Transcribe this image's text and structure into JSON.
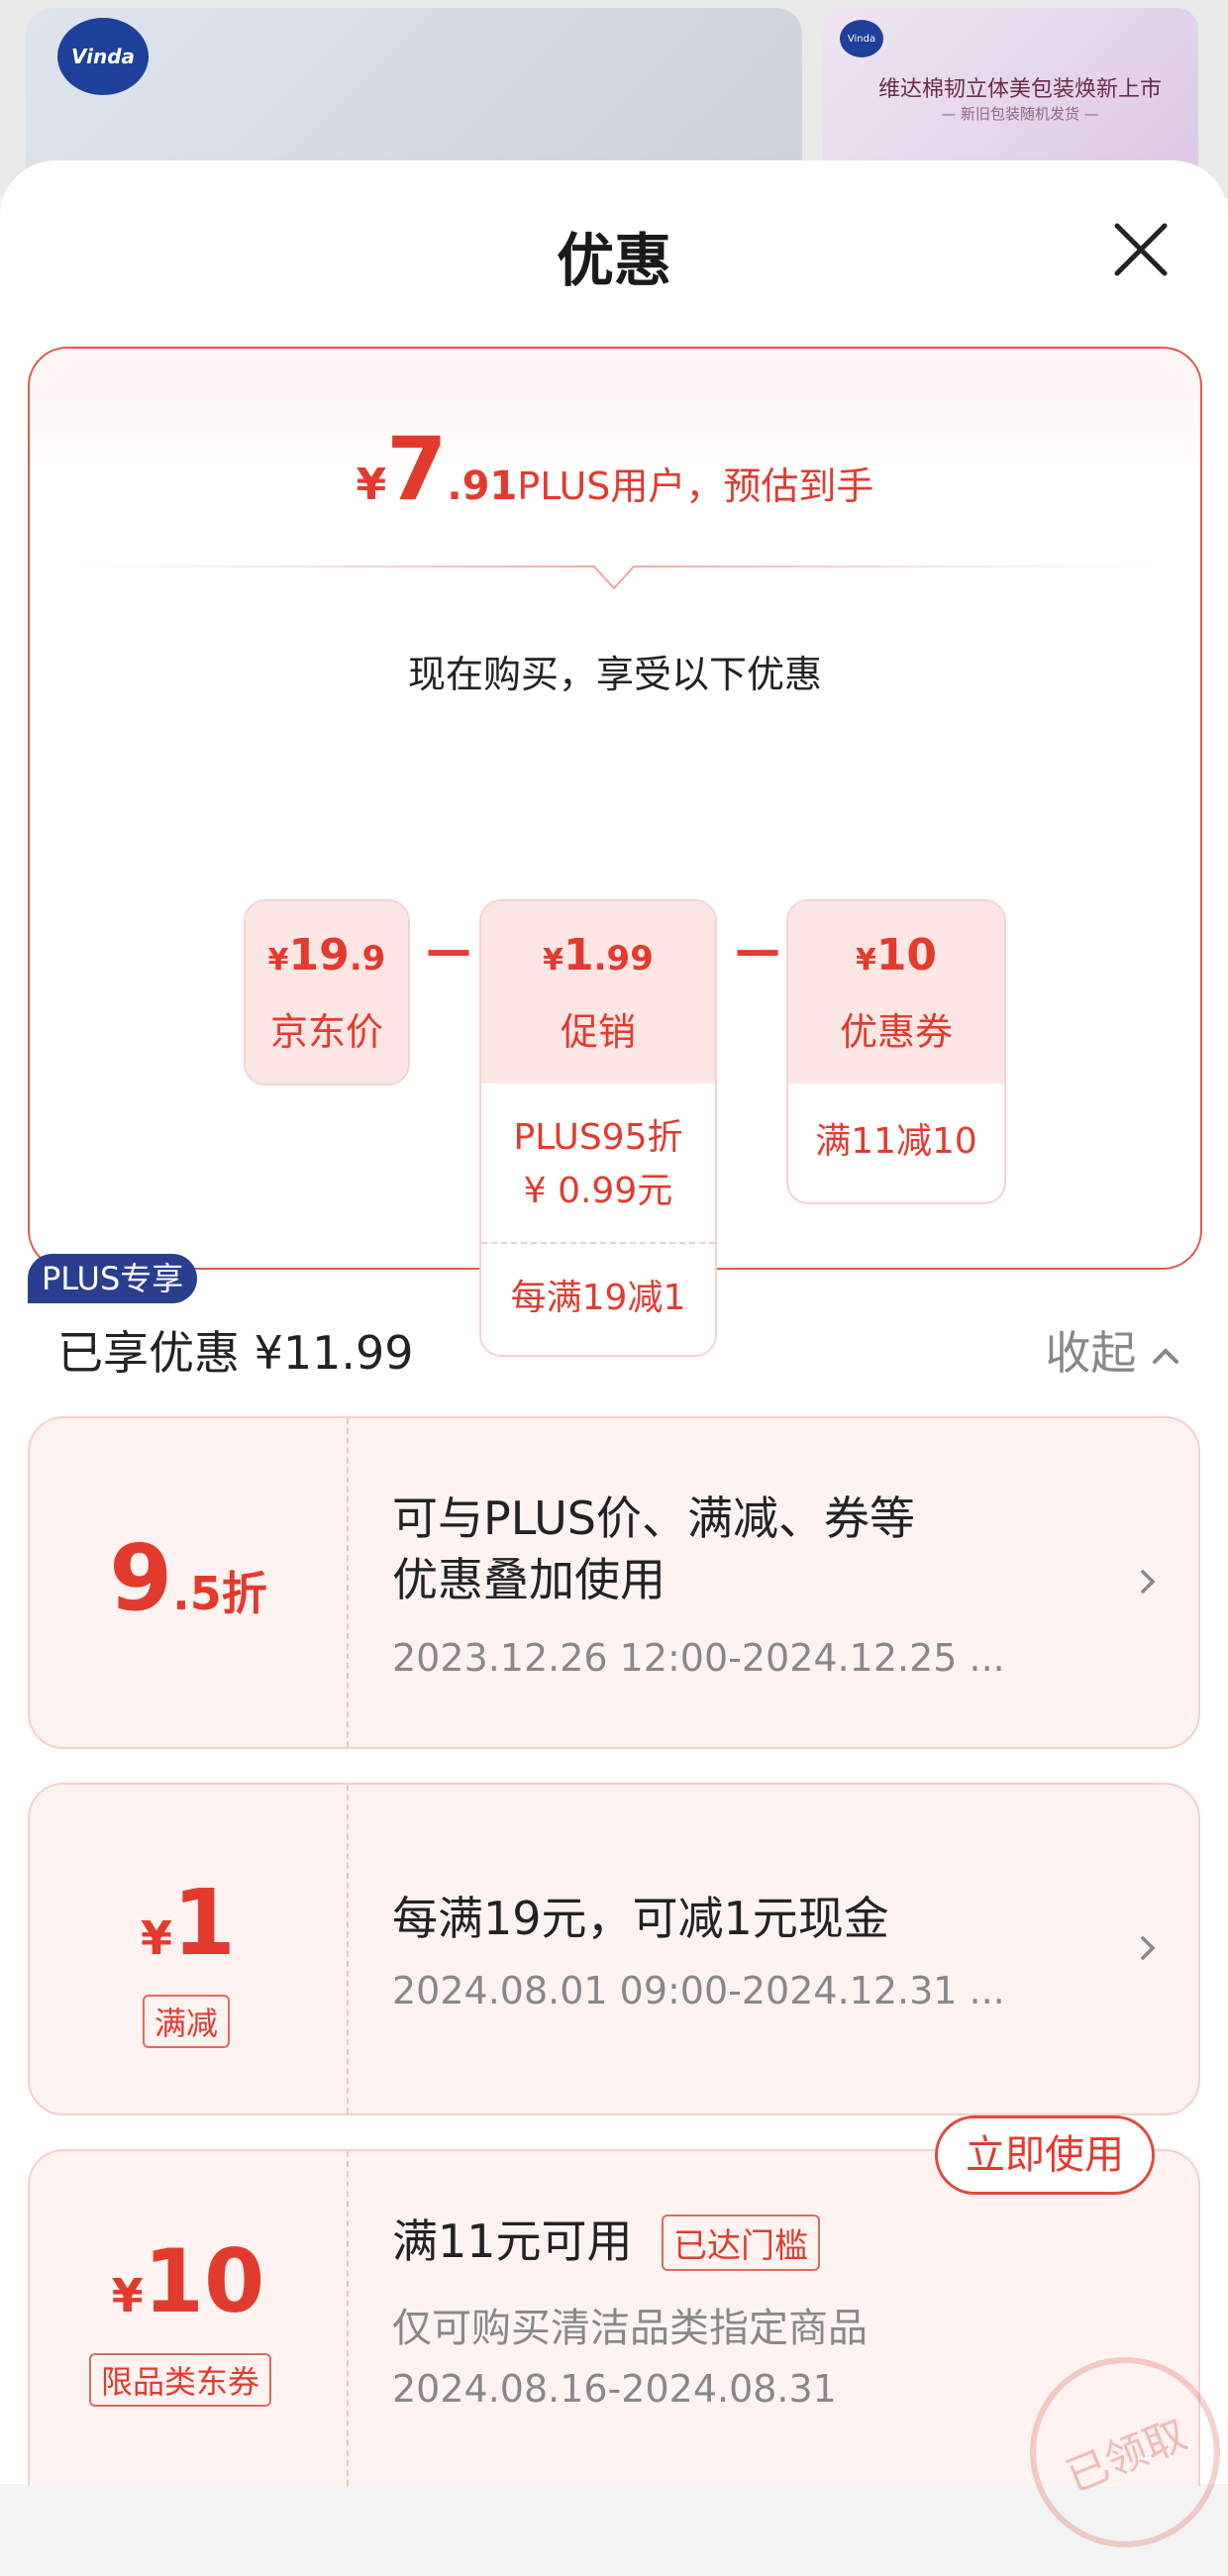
{
  "background": {
    "logo_text": "Vinda",
    "banner_title": "维达棉韧立体美包装焕新上市",
    "banner_sub": "— 新旧包装随机发货 —"
  },
  "sheet": {
    "title": "优惠",
    "close_icon": "close-icon"
  },
  "estimate": {
    "currency": "¥",
    "integer": "7",
    "decimal": ".91",
    "label": "PLUS用户，预估到手",
    "subtitle": "现在购买，享受以下优惠"
  },
  "breakdown": [
    {
      "symbol": "¥",
      "amount": "19",
      "decimal": ".9",
      "name": "京东价",
      "lines": []
    },
    {
      "symbol": "¥",
      "amount": "1",
      "decimal": ".99",
      "name": "促销",
      "lines": [
        "PLUS95折",
        "¥ 0.99元",
        "每满19减1"
      ]
    },
    {
      "symbol": "¥",
      "amount": "10",
      "decimal": "",
      "name": "优惠券",
      "lines": [
        "满11减10"
      ]
    }
  ],
  "minus_sign": "—",
  "summary": {
    "enjoyed": "已享优惠 ¥11.99",
    "collapse": "收起"
  },
  "coupons": [
    {
      "badge": "PLUS专享",
      "int": "9",
      "dec": ".5折",
      "text1": "可与PLUS价、满减、券等",
      "text2": "优惠叠加使用",
      "date": "2023.12.26 12:00-2024.12.25 ..."
    },
    {
      "currency": "¥",
      "amount": "1",
      "tag": "满减",
      "text": "每满19元，可减1元现金",
      "date": "2024.08.01 09:00-2024.12.31 ..."
    },
    {
      "currency": "¥",
      "amount": "10",
      "tag": "限品类东券",
      "title": "满11元可用",
      "status": "已达门槛",
      "desc": "仅可购买清洁品类指定商品",
      "date": "2024.08.16-2024.08.31",
      "button": "立即使用",
      "stamp": "已领取"
    }
  ],
  "colors": {
    "accent": "#e23b2e",
    "plus_badge": "#2a3d8e"
  }
}
